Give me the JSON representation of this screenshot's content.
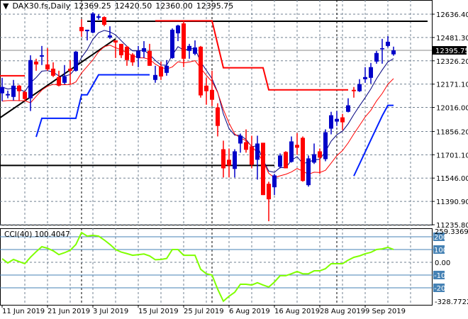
{
  "header": {
    "symbol": "DAX30.fs,Daily",
    "open": "12369.25",
    "high": "12420.50",
    "low": "12360.00",
    "close": "12395.75"
  },
  "colors": {
    "bull": "#0000c8",
    "bear": "#ff0000",
    "ma_fast": "#000080",
    "ma_slow": "#ff0000",
    "stop_low": "#0020ff",
    "stop_high": "#ff0000",
    "cci": "#7fff00",
    "cci_level": "#4682b4",
    "grid": "#708090"
  },
  "chart_data": [
    {
      "type": "candlestick",
      "title": "DAX30.fs,Daily",
      "ylim": [
        11235.8,
        12636.4
      ],
      "y_ticks": [
        "12636.40",
        "12481.30",
        "12326.20",
        "12171.10",
        "12016.00",
        "11856.20",
        "11701.10",
        "11546.00",
        "11390.90",
        "11235.80"
      ],
      "y_tick_values": [
        12636.4,
        12481.3,
        12326.2,
        12171.1,
        12016.0,
        11856.2,
        11701.1,
        11546.0,
        11390.9,
        11235.8
      ],
      "current_price": {
        "value": 12395.75,
        "label": "12395.75"
      },
      "x_labels": [
        {
          "bar": 0,
          "text": "11 Jun 2019"
        },
        {
          "bar": 8,
          "text": "21 Jun 2019"
        },
        {
          "bar": 16,
          "text": "3 Jul 2019"
        },
        {
          "bar": 24,
          "text": "15 Jul 2019"
        },
        {
          "bar": 32,
          "text": "25 Jul 2019"
        },
        {
          "bar": 40,
          "text": "6 Aug 2019"
        },
        {
          "bar": 48,
          "text": "16 Aug 2019"
        },
        {
          "bar": 56,
          "text": "28 Aug 2019"
        },
        {
          "bar": 64,
          "text": "9 Sep 2019"
        }
      ],
      "period_separators": [
        14,
        37,
        59
      ],
      "ohlc": [
        [
          12110,
          12213,
          12058,
          12152
        ],
        [
          12096,
          12128,
          12077,
          12105
        ],
        [
          12086,
          12199,
          12063,
          12161
        ],
        [
          12161,
          12166,
          12058,
          12124
        ],
        [
          12119,
          12128,
          12058,
          12072
        ],
        [
          12077,
          12363,
          11992,
          12331
        ],
        [
          12321,
          12340,
          12260,
          12302
        ],
        [
          12354,
          12425,
          12298,
          12363
        ],
        [
          12302,
          12410,
          12260,
          12269
        ],
        [
          12274,
          12316,
          12218,
          12227
        ],
        [
          12218,
          12260,
          12156,
          12161
        ],
        [
          12180,
          12298,
          12171,
          12222
        ],
        [
          12274,
          12331,
          12171,
          12260
        ],
        [
          12260,
          12392,
          12255,
          12387
        ],
        [
          12551,
          12603,
          12486,
          12523
        ],
        [
          12523,
          12533,
          12462,
          12533
        ],
        [
          12514,
          12650,
          12509,
          12641
        ],
        [
          12613,
          12636,
          12599,
          12622
        ],
        [
          12617,
          12622,
          12556,
          12566
        ],
        [
          12481,
          12556,
          12472,
          12495
        ],
        [
          12462,
          12462,
          12345,
          12448
        ],
        [
          12439,
          12439,
          12345,
          12363
        ],
        [
          12420,
          12425,
          12293,
          12331
        ],
        [
          12368,
          12378,
          12293,
          12316
        ],
        [
          12345,
          12425,
          12284,
          12392
        ],
        [
          12387,
          12457,
          12345,
          12410
        ],
        [
          12392,
          12439,
          12293,
          12293
        ],
        [
          12199,
          12293,
          12180,
          12232
        ],
        [
          12288,
          12321,
          12199,
          12222
        ],
        [
          12246,
          12331,
          12227,
          12293
        ],
        [
          12345,
          12542,
          12340,
          12533
        ],
        [
          12509,
          12566,
          12457,
          12561
        ],
        [
          12575,
          12589,
          12284,
          12340
        ],
        [
          12392,
          12439,
          12340,
          12425
        ],
        [
          12373,
          12462,
          12363,
          12415
        ],
        [
          12420,
          12425,
          12081,
          12096
        ],
        [
          12161,
          12213,
          12034,
          12124
        ],
        [
          12133,
          12260,
          12025,
          12067
        ],
        [
          12016,
          12044,
          11823,
          11893
        ],
        [
          11738,
          11795,
          11550,
          11611
        ],
        [
          11668,
          11743,
          11550,
          11630
        ],
        [
          11607,
          11738,
          11550,
          11724
        ],
        [
          11776,
          11842,
          11715,
          11828
        ],
        [
          11785,
          11870,
          11715,
          11734
        ],
        [
          11757,
          11828,
          11611,
          11635
        ],
        [
          11668,
          11828,
          11536,
          11776
        ],
        [
          11781,
          11781,
          11433,
          11433
        ],
        [
          11508,
          11522,
          11259,
          11405
        ],
        [
          11485,
          11574,
          11433,
          11564
        ],
        [
          11621,
          11710,
          11611,
          11696
        ],
        [
          11720,
          11725,
          11611,
          11611
        ],
        [
          11654,
          11823,
          11649,
          11790
        ],
        [
          11767,
          11846,
          11701,
          11748
        ],
        [
          11814,
          11823,
          11522,
          11527
        ],
        [
          11499,
          11696,
          11489,
          11677
        ],
        [
          11649,
          11776,
          11640,
          11705
        ],
        [
          11724,
          11743,
          11574,
          11682
        ],
        [
          11672,
          11870,
          11658,
          11851
        ],
        [
          11875,
          11987,
          11837,
          11964
        ],
        [
          11922,
          11992,
          11893,
          11940
        ],
        [
          11950,
          11973,
          11865,
          11917
        ],
        [
          11987,
          12077,
          11983,
          12030
        ],
        [
          12133,
          12152,
          12081,
          12124
        ],
        [
          12124,
          12204,
          12119,
          12171
        ],
        [
          12204,
          12284,
          12180,
          12218
        ],
        [
          12213,
          12312,
          12175,
          12284
        ],
        [
          12321,
          12392,
          12307,
          12378
        ],
        [
          12406,
          12472,
          12307,
          12410
        ],
        [
          12425,
          12490,
          12415,
          12453
        ],
        [
          12369.25,
          12420.5,
          12360,
          12395.75
        ]
      ],
      "stop_line_low": [
        [
          6,
          11820
        ],
        [
          7,
          11944
        ],
        [
          13,
          11944
        ],
        [
          14,
          12100
        ],
        [
          15,
          12100
        ],
        [
          17,
          12233
        ],
        [
          26,
          12233
        ],
        null,
        [
          62,
          11560
        ],
        [
          65,
          11800
        ],
        [
          67,
          11960
        ],
        [
          68,
          12030
        ],
        [
          69,
          12030
        ]
      ],
      "stop_line_high": [
        [
          -0.5,
          12227
        ],
        [
          4,
          12227
        ],
        null,
        [
          27,
          12592
        ],
        [
          37,
          12592
        ],
        [
          39,
          12280
        ],
        [
          46,
          12280
        ],
        [
          47,
          12133
        ],
        [
          61,
          12133
        ]
      ],
      "hlines": [
        {
          "from": 15,
          "to": 75,
          "value": 12589
        },
        {
          "from": -0.5,
          "to": 48,
          "value": 11630
        }
      ],
      "trendlines": [
        {
          "from": [
            -0.5,
            11944
          ],
          "to": [
            20,
            12472
          ]
        }
      ]
    },
    {
      "type": "line",
      "title": "CCI(40) 100.4047",
      "ylim": [
        -328.7722,
        259.3369
      ],
      "top_label": "259.3369",
      "bottom_label": "-328.7722",
      "zero_label": "0.00",
      "levels": [
        {
          "value": 200,
          "label": "200"
        },
        {
          "value": 100,
          "label": "100"
        },
        {
          "value": -100,
          "label": "-100"
        },
        {
          "value": -200,
          "label": "-200"
        }
      ],
      "values": [
        28,
        -5,
        22,
        5,
        -11,
        40,
        83,
        122,
        110,
        90,
        60,
        75,
        94,
        139,
        233,
        205,
        211,
        205,
        175,
        140,
        100,
        80,
        68,
        55,
        60,
        65,
        50,
        20,
        22,
        30,
        100,
        100,
        55,
        55,
        55,
        -55,
        -90,
        -100,
        -211,
        -305,
        -266,
        -235,
        -172,
        -172,
        -178,
        -160,
        -178,
        -194,
        -155,
        -105,
        -105,
        -90,
        -72,
        -90,
        -90,
        -67,
        -67,
        -50,
        -11,
        -11,
        -11,
        17,
        39,
        50,
        67,
        78,
        100,
        105,
        117,
        100.4
      ]
    }
  ]
}
